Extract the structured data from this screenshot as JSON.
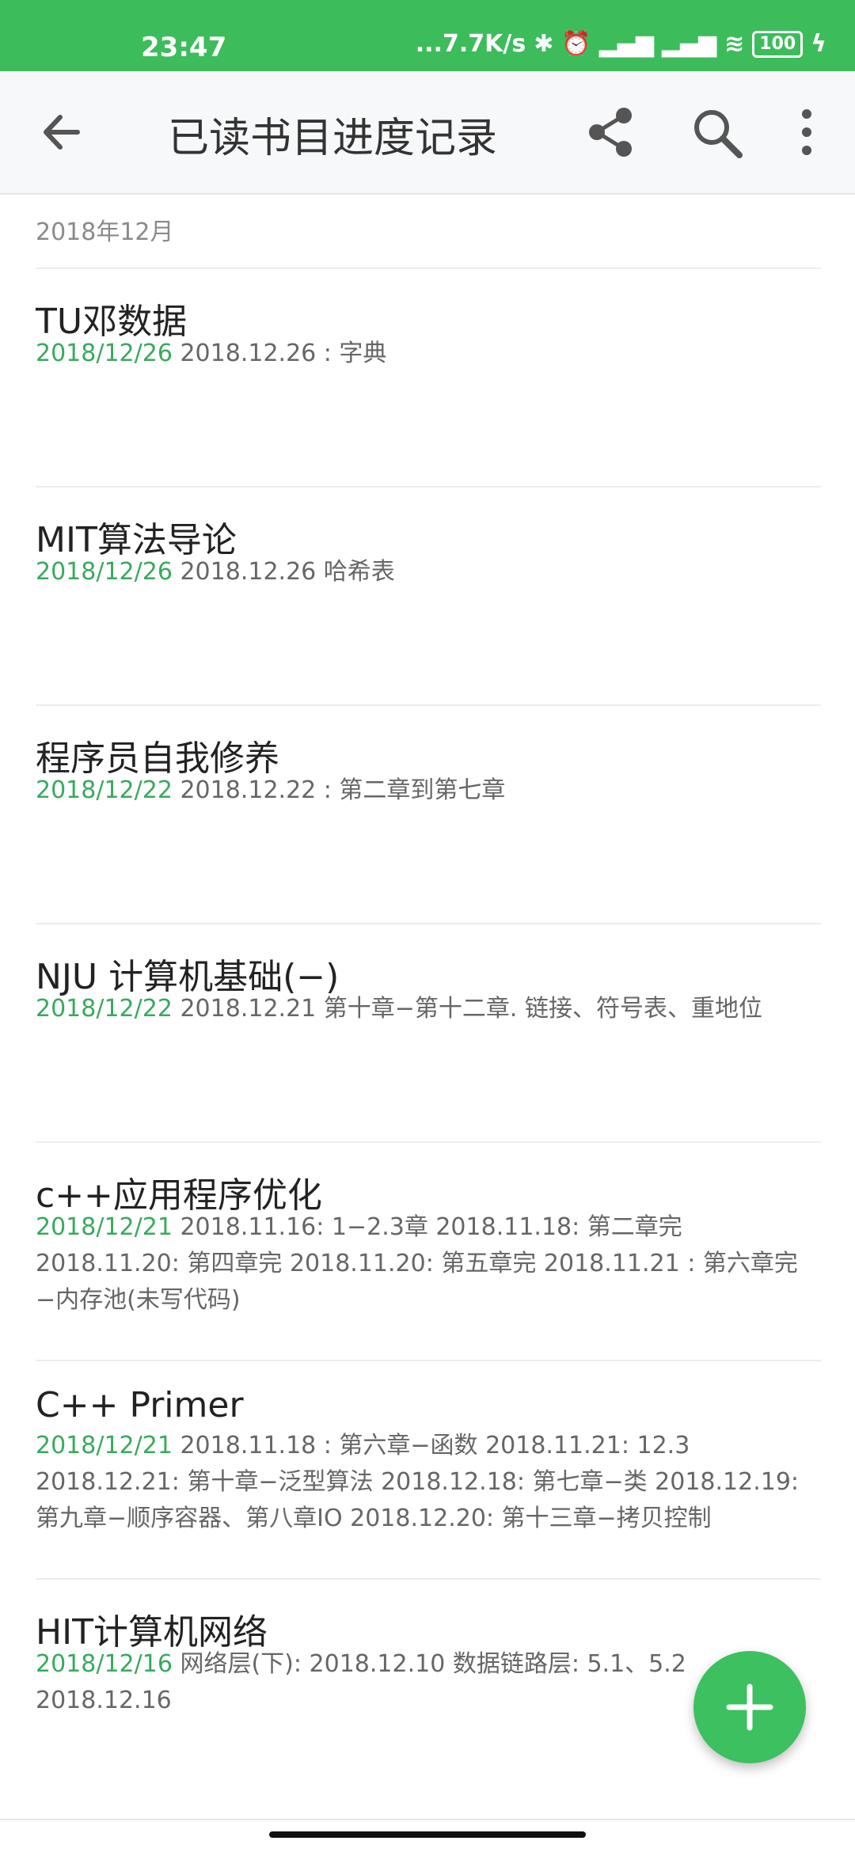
{
  "status_bar": {
    "time": "23:47",
    "network_speed": "...7.7K/s",
    "battery": "100"
  },
  "app_bar": {
    "title": "已读书目进度记录",
    "icons": [
      "back-arrow-icon",
      "share-icon",
      "search-icon",
      "more-vert-icon"
    ]
  },
  "section": {
    "header": "2018年12月"
  },
  "items": [
    {
      "title": "TU邓数据",
      "date": "2018/12/26",
      "text": "2018.12.26 : 字典"
    },
    {
      "title": "MIT算法导论",
      "date": "2018/12/26",
      "text": "2018.12.26 哈希表"
    },
    {
      "title": "程序员自我修养",
      "date": "2018/12/22",
      "text": "2018.12.22 : 第二章到第七章"
    },
    {
      "title": "NJU 计算机基础(−)",
      "date": "2018/12/22",
      "text": "2018.12.21 第十章−第十二章. 链接、符号表、重地位"
    },
    {
      "title": "c++应用程序优化",
      "date": "2018/12/21",
      "text": "2018.11.16: 1−2.3章 2018.11.18: 第二章完 2018.11.20: 第四章完 2018.11.20: 第五章完 2018.11.21 : 第六章完−内存池(未写代码)"
    },
    {
      "title": "C++ Primer",
      "date": "2018/12/21",
      "text": "2018.11.18 : 第六章−函数 2018.11.21: 12.3 2018.12.21: 第十章−泛型算法 2018.12.18: 第七章−类 2018.12.19: 第九章−顺序容器、第八章IO 2018.12.20: 第十三章−拷贝控制"
    },
    {
      "title": "HIT计算机网络",
      "date": "2018/12/16",
      "text": "网络层(下): 2018.12.10  数据链路层: 5.1、5.2 2018.12.16"
    }
  ],
  "fab": {
    "icon": "add-icon"
  },
  "colors": {
    "status_bar": "#3dbc5c",
    "accent_date": "#3aa95d",
    "fab": "#3cc060"
  }
}
